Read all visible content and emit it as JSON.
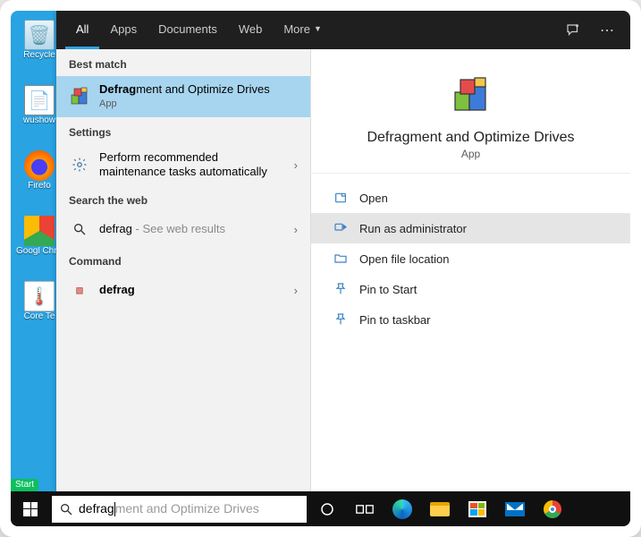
{
  "tabs": {
    "items": [
      "All",
      "Apps",
      "Documents",
      "Web",
      "More"
    ],
    "active_index": 0
  },
  "left": {
    "best_match_header": "Best match",
    "best_match": {
      "title_bold": "Defrag",
      "title_rest": "ment and Optimize Drives",
      "sub": "App"
    },
    "settings_header": "Settings",
    "settings_item": "Perform recommended maintenance tasks automatically",
    "web_header": "Search the web",
    "web_item_bold": "defrag",
    "web_item_hint": "See web results",
    "command_header": "Command",
    "command_item": "defrag"
  },
  "hero": {
    "title": "Defragment and Optimize Drives",
    "sub": "App"
  },
  "actions": {
    "open": "Open",
    "run_admin": "Run as administrator",
    "open_loc": "Open file location",
    "pin_start": "Pin to Start",
    "pin_taskbar": "Pin to taskbar"
  },
  "search": {
    "typed": "defrag",
    "suggestion_rest": "ment and Optimize Drives"
  },
  "desktop": {
    "icons": [
      {
        "label": "Recycle"
      },
      {
        "label": "wushow"
      },
      {
        "label": "Firefo"
      },
      {
        "label": "Googl Chrom"
      },
      {
        "label": "Core Te"
      }
    ],
    "start_tag": "Start"
  }
}
